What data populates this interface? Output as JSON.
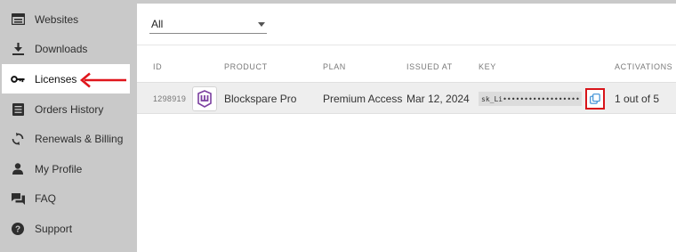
{
  "sidebar": {
    "items": [
      {
        "label": "Websites",
        "icon": "browser-window-icon"
      },
      {
        "label": "Downloads",
        "icon": "download-icon"
      },
      {
        "label": "Licenses",
        "icon": "key-icon"
      },
      {
        "label": "Orders History",
        "icon": "list-icon"
      },
      {
        "label": "Renewals & Billing",
        "icon": "refresh-icon"
      },
      {
        "label": "My Profile",
        "icon": "user-icon"
      },
      {
        "label": "FAQ",
        "icon": "chat-icon"
      },
      {
        "label": "Support",
        "icon": "help-circle-icon"
      }
    ],
    "active_item": "Licenses"
  },
  "filter": {
    "value": "All"
  },
  "table": {
    "headers": [
      "ID",
      "PRODUCT",
      "PLAN",
      "ISSUED AT",
      "KEY",
      "ACTIVATIONS"
    ],
    "rows": [
      {
        "id": "1298919",
        "product": "Blockspare Pro",
        "plan": "Premium Access",
        "issued_at": "Mar 12, 2024",
        "key": "sk_Li••••••••••••••••••",
        "activations": "1 out of 5"
      }
    ]
  },
  "colors": {
    "sidebar_bg": "#c9c9c9",
    "highlight": "#d8141a",
    "product_icon": "#7b3fa0",
    "copy_icon": "#3a8fd6"
  }
}
